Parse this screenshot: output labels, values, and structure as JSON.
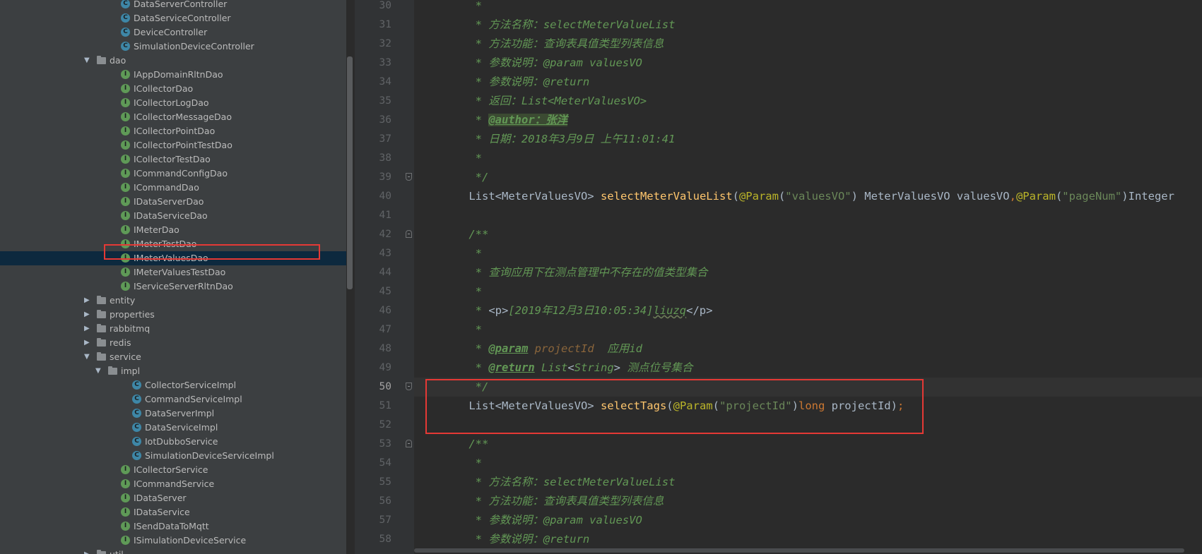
{
  "tree": {
    "rows": [
      {
        "label": "DataServerController",
        "kind": "class",
        "indent": 2,
        "expanded": null
      },
      {
        "label": "DataServiceController",
        "kind": "class",
        "indent": 2,
        "expanded": null
      },
      {
        "label": "DeviceController",
        "kind": "class",
        "indent": 2,
        "expanded": null
      },
      {
        "label": "SimulationDeviceController",
        "kind": "class",
        "indent": 2,
        "expanded": null
      },
      {
        "label": "dao",
        "kind": "folder",
        "indent": 1,
        "expanded": true
      },
      {
        "label": "IAppDomainRltnDao",
        "kind": "interface",
        "indent": 2,
        "expanded": null
      },
      {
        "label": "ICollectorDao",
        "kind": "interface",
        "indent": 2,
        "expanded": null
      },
      {
        "label": "ICollectorLogDao",
        "kind": "interface",
        "indent": 2,
        "expanded": null
      },
      {
        "label": "ICollectorMessageDao",
        "kind": "interface",
        "indent": 2,
        "expanded": null
      },
      {
        "label": "ICollectorPointDao",
        "kind": "interface",
        "indent": 2,
        "expanded": null
      },
      {
        "label": "ICollectorPointTestDao",
        "kind": "interface",
        "indent": 2,
        "expanded": null
      },
      {
        "label": "ICollectorTestDao",
        "kind": "interface",
        "indent": 2,
        "expanded": null
      },
      {
        "label": "ICommandConfigDao",
        "kind": "interface",
        "indent": 2,
        "expanded": null
      },
      {
        "label": "ICommandDao",
        "kind": "interface",
        "indent": 2,
        "expanded": null
      },
      {
        "label": "IDataServerDao",
        "kind": "interface",
        "indent": 2,
        "expanded": null
      },
      {
        "label": "IDataServiceDao",
        "kind": "interface",
        "indent": 2,
        "expanded": null
      },
      {
        "label": "IMeterDao",
        "kind": "interface",
        "indent": 2,
        "expanded": null
      },
      {
        "label": "IMeterTestDao",
        "kind": "interface",
        "indent": 2,
        "expanded": null
      },
      {
        "label": "IMeterValuesDao",
        "kind": "interface",
        "indent": 2,
        "expanded": null,
        "selected": true
      },
      {
        "label": "IMeterValuesTestDao",
        "kind": "interface",
        "indent": 2,
        "expanded": null
      },
      {
        "label": "IServiceServerRltnDao",
        "kind": "interface",
        "indent": 2,
        "expanded": null
      },
      {
        "label": "entity",
        "kind": "folder",
        "indent": 1,
        "expanded": false
      },
      {
        "label": "properties",
        "kind": "folder",
        "indent": 1,
        "expanded": false
      },
      {
        "label": "rabbitmq",
        "kind": "folder",
        "indent": 1,
        "expanded": false
      },
      {
        "label": "redis",
        "kind": "folder",
        "indent": 1,
        "expanded": false
      },
      {
        "label": "service",
        "kind": "folder",
        "indent": 1,
        "expanded": true
      },
      {
        "label": "impl",
        "kind": "folder",
        "indent": 2,
        "expanded": true
      },
      {
        "label": "CollectorServiceImpl",
        "kind": "class",
        "indent": 3,
        "expanded": null
      },
      {
        "label": "CommandServiceImpl",
        "kind": "class",
        "indent": 3,
        "expanded": null
      },
      {
        "label": "DataServerImpl",
        "kind": "class",
        "indent": 3,
        "expanded": null
      },
      {
        "label": "DataServiceImpl",
        "kind": "class",
        "indent": 3,
        "expanded": null
      },
      {
        "label": "IotDubboService",
        "kind": "class",
        "indent": 3,
        "expanded": null
      },
      {
        "label": "SimulationDeviceServiceImpl",
        "kind": "class",
        "indent": 3,
        "expanded": null
      },
      {
        "label": "ICollectorService",
        "kind": "interface",
        "indent": 2,
        "expanded": null
      },
      {
        "label": "ICommandService",
        "kind": "interface",
        "indent": 2,
        "expanded": null
      },
      {
        "label": "IDataServer",
        "kind": "interface",
        "indent": 2,
        "expanded": null
      },
      {
        "label": "IDataService",
        "kind": "interface",
        "indent": 2,
        "expanded": null
      },
      {
        "label": "ISendDataToMqtt",
        "kind": "interface",
        "indent": 2,
        "expanded": null
      },
      {
        "label": "ISimulationDeviceService",
        "kind": "interface",
        "indent": 2,
        "expanded": null
      },
      {
        "label": "util",
        "kind": "folder",
        "indent": 1,
        "expanded": false
      }
    ]
  },
  "editor": {
    "current_line": 50,
    "lines": [
      {
        "n": "30",
        "fold": null,
        "tokens": [
          {
            "t": "     *",
            "c": "doc"
          }
        ]
      },
      {
        "n": "31",
        "fold": null,
        "tokens": [
          {
            "t": "     * 方法名称：selectMeterValueList",
            "c": "doc"
          }
        ]
      },
      {
        "n": "32",
        "fold": null,
        "tokens": [
          {
            "t": "     * 方法功能：查询表具值类型列表信息",
            "c": "doc"
          }
        ]
      },
      {
        "n": "33",
        "fold": null,
        "tokens": [
          {
            "t": "     * 参数说明：@param valuesVO",
            "c": "doc"
          }
        ]
      },
      {
        "n": "34",
        "fold": null,
        "tokens": [
          {
            "t": "     * 参数说明：@return",
            "c": "doc"
          }
        ]
      },
      {
        "n": "35",
        "fold": null,
        "tokens": [
          {
            "t": "     * 返回：List<MeterValuesVO>",
            "c": "doc"
          }
        ]
      },
      {
        "n": "36",
        "fold": null,
        "tokens": [
          {
            "t": "     * ",
            "c": "doc"
          },
          {
            "t": "@author：张洋",
            "c": "author"
          }
        ]
      },
      {
        "n": "37",
        "fold": null,
        "tokens": [
          {
            "t": "     * 日期：2018年3月9日 上午11:01:41",
            "c": "doc"
          }
        ]
      },
      {
        "n": "38",
        "fold": null,
        "tokens": [
          {
            "t": "     *",
            "c": "doc"
          }
        ]
      },
      {
        "n": "39",
        "fold": "up",
        "tokens": [
          {
            "t": "     */",
            "c": "doc"
          }
        ]
      },
      {
        "n": "40",
        "fold": null,
        "tokens": [
          {
            "t": "    List<MeterValuesVO> ",
            "c": ""
          },
          {
            "t": "selectMeterValueList",
            "c": "mth"
          },
          {
            "t": "(",
            "c": ""
          },
          {
            "t": "@Param",
            "c": "ann"
          },
          {
            "t": "(",
            "c": ""
          },
          {
            "t": "\"valuesVO\"",
            "c": "str"
          },
          {
            "t": ") MeterValuesVO valuesVO",
            "c": ""
          },
          {
            "t": ",",
            "c": "kw"
          },
          {
            "t": "@Param",
            "c": "ann"
          },
          {
            "t": "(",
            "c": ""
          },
          {
            "t": "\"pageNum\"",
            "c": "str"
          },
          {
            "t": ")Integer",
            "c": ""
          }
        ]
      },
      {
        "n": "41",
        "fold": null,
        "tokens": [
          {
            "t": "",
            "c": ""
          }
        ]
      },
      {
        "n": "42",
        "fold": "down",
        "tokens": [
          {
            "t": "    /**",
            "c": "doc"
          }
        ]
      },
      {
        "n": "43",
        "fold": null,
        "tokens": [
          {
            "t": "     *",
            "c": "doc"
          }
        ]
      },
      {
        "n": "44",
        "fold": null,
        "tokens": [
          {
            "t": "     * 查询应用下在测点管理中不存在的值类型集合",
            "c": "doc"
          }
        ]
      },
      {
        "n": "45",
        "fold": null,
        "tokens": [
          {
            "t": "     *",
            "c": "doc"
          }
        ]
      },
      {
        "n": "46",
        "fold": null,
        "tokens": [
          {
            "t": "     * ",
            "c": "doc"
          },
          {
            "t": "<p>",
            "c": ""
          },
          {
            "t": "[2019年12月3日10:05:34]",
            "c": "doc"
          },
          {
            "t": "liuzq",
            "c": "doc wavy"
          },
          {
            "t": "</p>",
            "c": ""
          }
        ]
      },
      {
        "n": "47",
        "fold": null,
        "tokens": [
          {
            "t": "     *",
            "c": "doc"
          }
        ]
      },
      {
        "n": "48",
        "fold": null,
        "tokens": [
          {
            "t": "     * ",
            "c": "doc"
          },
          {
            "t": "@param",
            "c": "doctag"
          },
          {
            "t": " ",
            "c": "doc"
          },
          {
            "t": "projectId",
            "c": "docparam"
          },
          {
            "t": "  应用id",
            "c": "doc"
          }
        ]
      },
      {
        "n": "49",
        "fold": null,
        "tokens": [
          {
            "t": "     * ",
            "c": "doc"
          },
          {
            "t": "@return",
            "c": "doctag"
          },
          {
            "t": " List",
            "c": "doc"
          },
          {
            "t": "<",
            "c": ""
          },
          {
            "t": "String",
            "c": "doc"
          },
          {
            "t": ">",
            "c": ""
          },
          {
            "t": " 测点位号集合",
            "c": "doc"
          }
        ]
      },
      {
        "n": "50",
        "fold": "up",
        "tokens": [
          {
            "t": "     */",
            "c": "doc"
          }
        ]
      },
      {
        "n": "51",
        "fold": null,
        "tokens": [
          {
            "t": "    List<MeterValuesVO> ",
            "c": ""
          },
          {
            "t": "selectTags",
            "c": "mth"
          },
          {
            "t": "(",
            "c": ""
          },
          {
            "t": "@Param",
            "c": "ann"
          },
          {
            "t": "(",
            "c": ""
          },
          {
            "t": "\"projectId\"",
            "c": "str"
          },
          {
            "t": ")",
            "c": ""
          },
          {
            "t": "long",
            "c": "kw"
          },
          {
            "t": " projectId)",
            "c": ""
          },
          {
            "t": ";",
            "c": "kw"
          }
        ]
      },
      {
        "n": "52",
        "fold": null,
        "tokens": [
          {
            "t": "",
            "c": ""
          }
        ]
      },
      {
        "n": "53",
        "fold": "down",
        "tokens": [
          {
            "t": "    /**",
            "c": "doc"
          }
        ]
      },
      {
        "n": "54",
        "fold": null,
        "tokens": [
          {
            "t": "     *",
            "c": "doc"
          }
        ]
      },
      {
        "n": "55",
        "fold": null,
        "tokens": [
          {
            "t": "     * 方法名称：selectMeterValueList",
            "c": "doc"
          }
        ]
      },
      {
        "n": "56",
        "fold": null,
        "tokens": [
          {
            "t": "     * 方法功能：查询表具值类型列表信息",
            "c": "doc"
          }
        ]
      },
      {
        "n": "57",
        "fold": null,
        "tokens": [
          {
            "t": "     * 参数说明：@param valuesVO",
            "c": "doc"
          }
        ]
      },
      {
        "n": "58",
        "fold": null,
        "tokens": [
          {
            "t": "     * 参数说明：@return",
            "c": "doc"
          }
        ]
      }
    ]
  },
  "colors": {
    "sidebar_bg": "#3c3f41",
    "editor_bg": "#2b2b2b",
    "gutter_bg": "#313335",
    "highlight_red": "#e53935",
    "selection_bg": "#0d293e"
  }
}
